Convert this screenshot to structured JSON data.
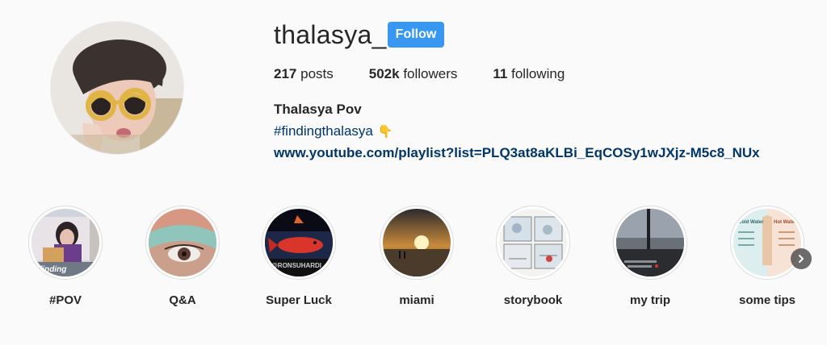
{
  "profile": {
    "username": "thalasya_",
    "follow_label": "Follow",
    "full_name": "Thalasya Pov",
    "bio_hashtag": "#findingthalasya",
    "bio_emoji": "👇",
    "website": "www.youtube.com/playlist?list=PLQ3at8aKLBi_EqCOSy1wJXjz-M5c8_NUx"
  },
  "stats": {
    "posts_count": "217",
    "posts_label": "posts",
    "followers_count": "502k",
    "followers_label": "followers",
    "following_count": "11",
    "following_label": "following"
  },
  "highlights": [
    {
      "label": "#POV",
      "thumb_text": "finding"
    },
    {
      "label": "Q&A"
    },
    {
      "label": "Super Luck",
      "thumb_text": "@RONSUHARDI"
    },
    {
      "label": "miami"
    },
    {
      "label": "storybook"
    },
    {
      "label": "my trip"
    },
    {
      "label": "some tips",
      "thumb_text_left": "Cold Water",
      "thumb_text_right": "Hot Water"
    }
  ],
  "colors": {
    "accent": "#3897f0",
    "link": "#003569",
    "background": "#fafafa",
    "text": "#262626"
  },
  "icons": {
    "next": "chevron-right-icon"
  }
}
